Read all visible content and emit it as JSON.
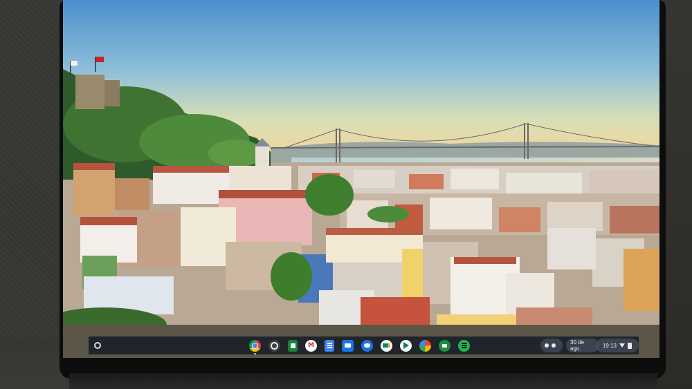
{
  "shelf": {
    "launcher_icon": "launcher-circle-icon",
    "apps": [
      {
        "name": "Chrome",
        "icon": "chrome-icon"
      },
      {
        "name": "Camera",
        "icon": "camera-icon"
      },
      {
        "name": "Sheets",
        "icon": "sheets-icon"
      },
      {
        "name": "Gmail",
        "icon": "gmail-icon"
      },
      {
        "name": "Docs",
        "icon": "docs-icon"
      },
      {
        "name": "Files",
        "icon": "files-icon"
      },
      {
        "name": "Messages",
        "icon": "messages-icon"
      },
      {
        "name": "Meet",
        "icon": "meet-icon"
      },
      {
        "name": "Play Store",
        "icon": "play-store-icon"
      },
      {
        "name": "Photos",
        "icon": "photos-icon"
      },
      {
        "name": "Duo",
        "icon": "duo-icon"
      },
      {
        "name": "Spotify",
        "icon": "spotify-icon"
      }
    ],
    "date": "30 de ago.",
    "time": "19:13"
  },
  "colors": {
    "sky_top": "#4f94cf",
    "sky_horizon": "#f4d69a",
    "shelf_bg": "#141a24"
  }
}
